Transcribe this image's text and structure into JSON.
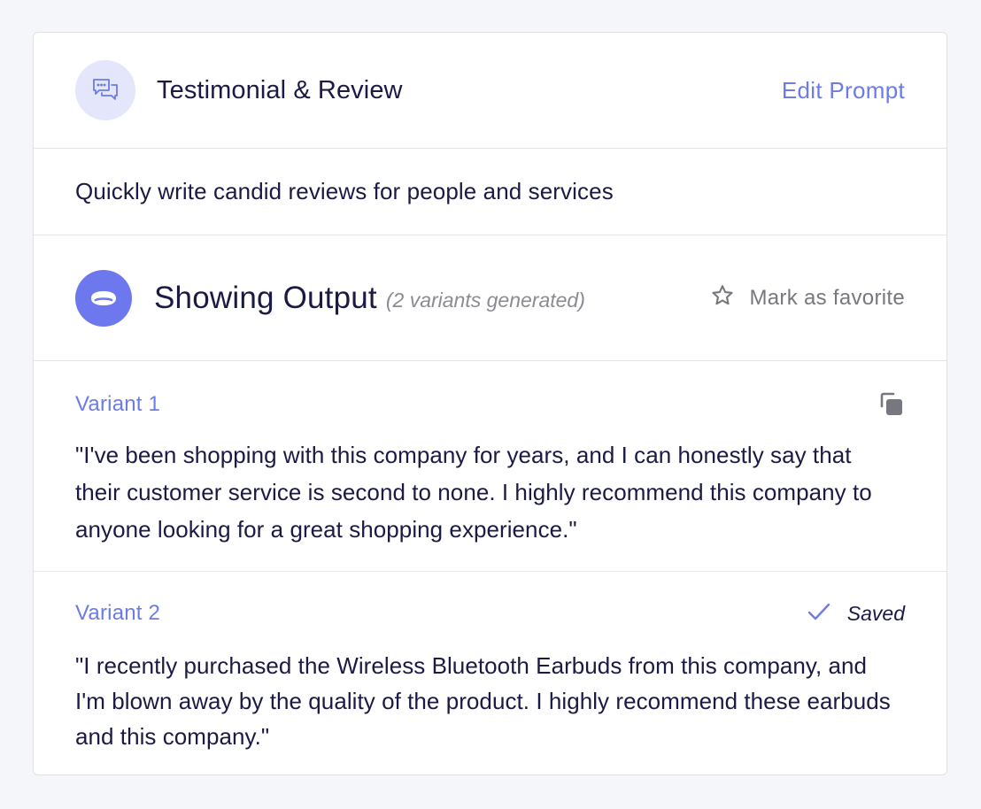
{
  "header": {
    "title": "Testimonial & Review",
    "edit_label": "Edit Prompt",
    "icon": "chat-bubbles-icon"
  },
  "description": "Quickly write candid reviews for people and services",
  "output": {
    "title": "Showing Output",
    "subtitle": "(2 variants generated)",
    "favorite_label": "Mark as favorite",
    "icon": "output-pill-icon"
  },
  "variants": [
    {
      "label": "Variant 1",
      "text": "\"I've been shopping with this company for years, and I can honestly say that their customer service is second to none. I highly recommend this company to anyone looking for a great shopping experience.\"",
      "action_icon": "copy-icon"
    },
    {
      "label": "Variant 2",
      "status": "Saved",
      "text": "\"I recently purchased the Wireless Bluetooth Earbuds from this company, and I'm blown away by the quality of the product. I highly recommend these earbuds and this company.\"",
      "action_icon": "check-icon"
    }
  ],
  "colors": {
    "accent": "#6d7be6",
    "text": "#1b1a45",
    "muted": "#77777f",
    "icon_bg": "#e4e7fb",
    "output_icon": "#6e78ee"
  }
}
